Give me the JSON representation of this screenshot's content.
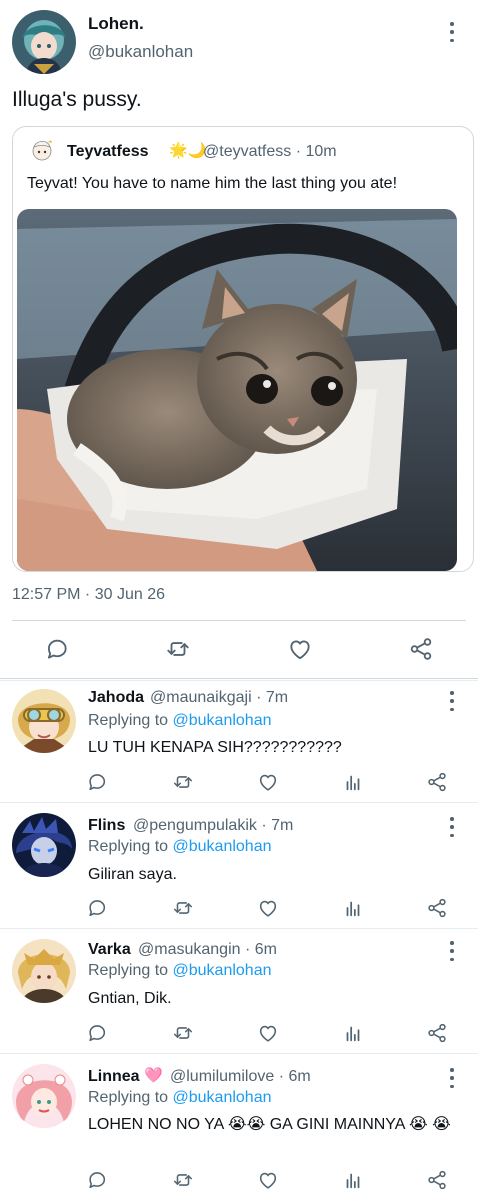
{
  "main_tweet": {
    "display_name": "Lohen.",
    "handle": "@bukanlohan",
    "text": "Illuga's pussy.",
    "timestamp": "12:57 PM · 30 Jun 26"
  },
  "quoted_tweet": {
    "display_name": "Teyvatfess",
    "name_emoji": "🌟🌙",
    "meta": "@teyvatfess · 10m",
    "text": "Teyvat! You have to name him the last thing you ate!",
    "image_alt": "kitten on a paper towel in a hand"
  },
  "replying_label": "Replying to ",
  "replies": [
    {
      "display_name": "Jahoda",
      "name_emoji": "",
      "meta": "@maunaikgaji · 7m",
      "replying_to": "@bukanlohan",
      "text": "LU TUH KENAPA SIH???????????"
    },
    {
      "display_name": "Flins",
      "name_emoji": "",
      "meta": "@pengumpulakik · 7m",
      "replying_to": "@bukanlohan",
      "text": "Giliran saya."
    },
    {
      "display_name": "Varka",
      "name_emoji": "",
      "meta": "@masukangin · 6m",
      "replying_to": "@bukanlohan",
      "text": "Gntian, Dik."
    },
    {
      "display_name": "Linnea",
      "name_emoji": "🩷",
      "meta": "@lumilumilove · 6m",
      "replying_to": "@bukanlohan",
      "text": "LOHEN NO NO YA 😭😭 GA GINI MAINNYA 😭 😭"
    }
  ],
  "icons": {
    "reply": "reply-icon",
    "retweet": "retweet-icon",
    "like": "like-icon",
    "share": "share-icon",
    "analytics": "analytics-icon",
    "more": "more-icon"
  },
  "colors": {
    "text": "#0f1419",
    "secondary": "#536471",
    "link": "#1d9bf0",
    "border": "#cfd9de"
  }
}
